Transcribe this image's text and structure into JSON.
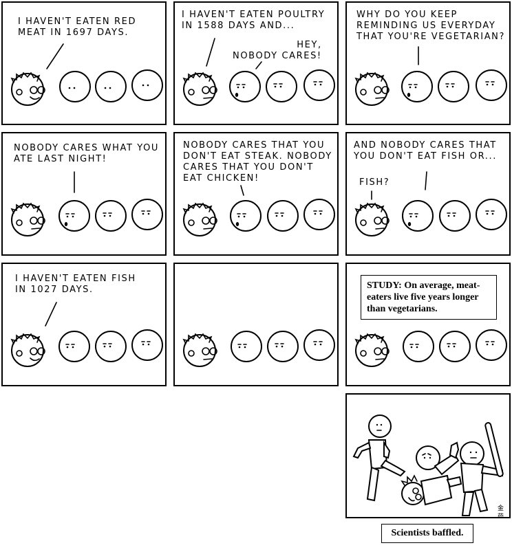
{
  "panels": [
    {
      "caption": "I haven't eaten red\nmeat in 1697 days."
    },
    {
      "caption": "I haven't eaten poultry\nin 1588 days and...",
      "reply": "Hey,\nnobody cares!"
    },
    {
      "caption": "Why do you keep\nreminding us everyday\nthat you're vegetarian?"
    },
    {
      "caption": "Nobody cares what you\nate last night!"
    },
    {
      "caption": "Nobody cares that you\ndon't eat steak. Nobody\ncares that you don't\neat chicken!"
    },
    {
      "caption": "And nobody cares that\nyou don't eat fish or...",
      "reply": "Fish?"
    },
    {
      "caption": "I haven't eaten fish\nin 1027 days."
    },
    {
      "caption": ""
    },
    {
      "study": "STUDY: On average, meat-eaters live five years longer than vegetarians."
    },
    {
      "signature": "金 药 悸"
    }
  ],
  "footer": {
    "caption": "Scientists baffled."
  }
}
